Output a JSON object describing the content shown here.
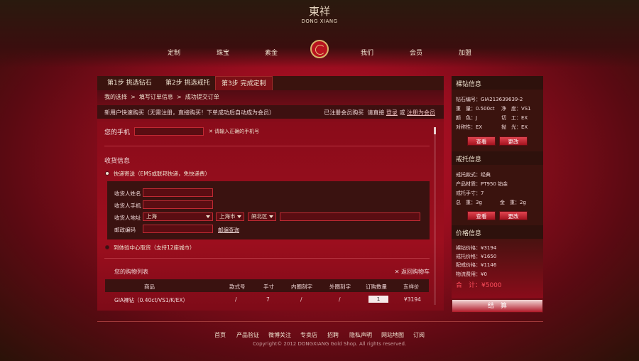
{
  "brand": {
    "logo_cn": "東祥",
    "logo_en": "DONG XIANG"
  },
  "nav": [
    "定制",
    "珠宝",
    "素金",
    "我们",
    "会员",
    "加盟"
  ],
  "steps": [
    "第1步  挑选钻石",
    "第2步  挑选戒托",
    "第3步  完成定制"
  ],
  "breadcrumb": [
    "我的选择",
    "填写订单信息",
    "成功提交订单"
  ],
  "notice": {
    "left": "新用户快速购买（无需注册，直接购买！下单成功后自动成为会员）",
    "registered": "已注册会员购买",
    "prompt": "请直接",
    "login": "登录",
    "or": "或",
    "register": "注册为会员"
  },
  "phone": {
    "label": "您的手机",
    "hint": "请输入正确的手机号"
  },
  "shipping": {
    "title": "收货信息",
    "express": "快递寄送（EMS或联邦快递，免快递费）",
    "name_label": "收货人姓名",
    "mobile_label": "收货人手机",
    "address_label": "收货人地址",
    "postcode_label": "邮政编码",
    "province": "上海",
    "city": "上海市",
    "district": "闸北区",
    "postcode_link": "邮编查询",
    "pickup": "到体验中心取货（支持12座城市）"
  },
  "cart": {
    "title": "您的购物列表",
    "back": "返回购物车",
    "headers": [
      "商品",
      "款式号",
      "手寸",
      "内圈刻字",
      "外圈刻字",
      "订购数量",
      "东祥价"
    ],
    "rows": [
      {
        "product": "GIA裸钻（0.40ct/VS1/K/EX）",
        "style": "/",
        "size": "7",
        "inner": "/",
        "outer": "/",
        "qty": "1",
        "price": "¥3194"
      }
    ]
  },
  "sidebar": {
    "diamond": {
      "title": "裸钻信息",
      "code": "钻石编号：GIA213639639-2",
      "weight_l": "重　量：0.500ct",
      "clarity": "净　度：VS1",
      "color": "颜　色：J",
      "cut": "切　工：EX",
      "symmetry": "对称性：EX",
      "polish": "抛　光：EX",
      "view": "查看",
      "change": "更改"
    },
    "ring": {
      "title": "戒托信息",
      "style": "戒托款式：经典",
      "material": "产品材质：PT950 铂金",
      "size": "戒托手寸：7",
      "total_weight": "总　重：3g",
      "gold_weight": "金　重：2g",
      "view": "查看",
      "change": "更改"
    },
    "price": {
      "title": "价格信息",
      "diamond": "裸钻价格：¥3194",
      "ring": "戒托价格：¥1650",
      "setting": "配戒价格：¥1146",
      "shipping": "物流费用：¥0",
      "total": "合　计：¥5000"
    },
    "checkout": "结　算"
  },
  "footer": {
    "links": [
      "首页",
      "产品验证",
      "微博关注",
      "专卖店",
      "招聘",
      "隐私声明",
      "网站地图",
      "订阅"
    ],
    "copyright": "Copyright© 2012 DONGXIANG Gold Shop. All rights reserved."
  },
  "colors": {
    "accent": "#c4142a",
    "dark": "#3a130e",
    "total": "#ff4d5c"
  }
}
